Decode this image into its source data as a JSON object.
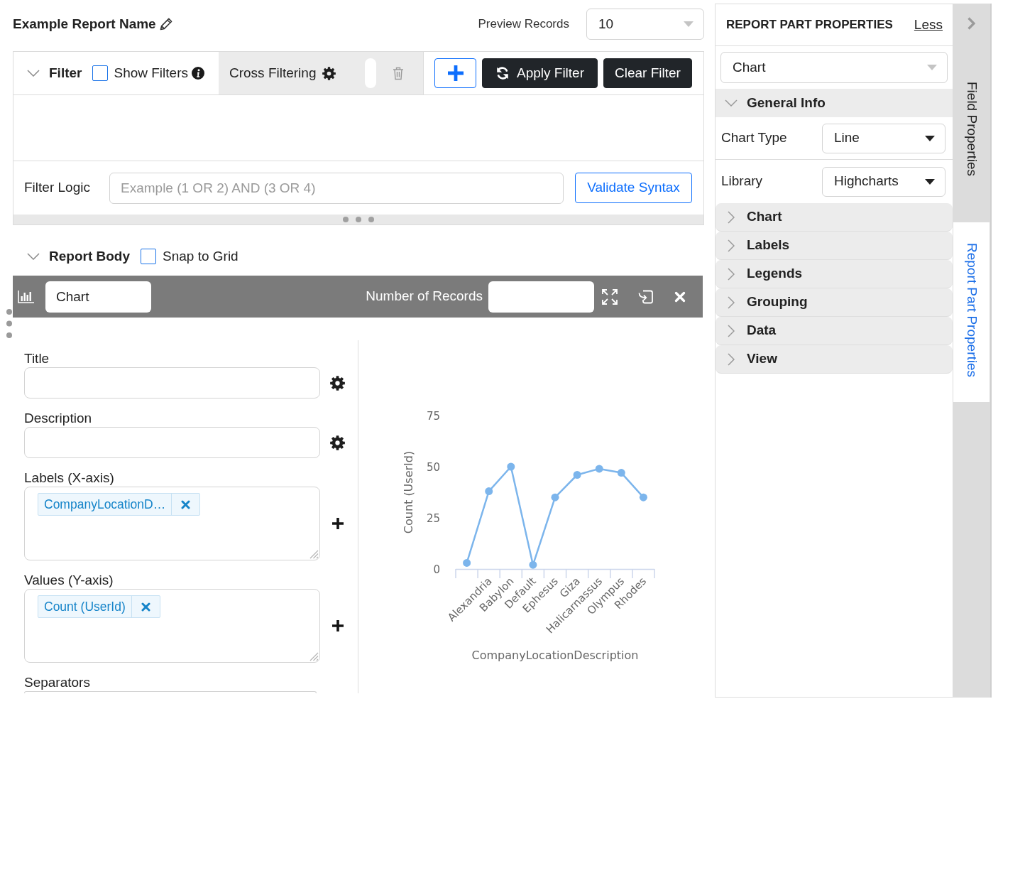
{
  "report": {
    "name": "Example Report Name",
    "preview_label": "Preview Records",
    "preview_value": "10"
  },
  "filter": {
    "title": "Filter",
    "expanded": true,
    "show_filters": {
      "label": "Show Filters",
      "checked": false
    },
    "cross_filtering": {
      "label": "Cross Filtering"
    },
    "buttons": [
      {
        "kind": "add"
      },
      {
        "kind": "apply",
        "label": "Apply Filter"
      },
      {
        "kind": "clear",
        "label": "Clear Filter"
      }
    ],
    "logic": {
      "label": "Filter Logic",
      "placeholder": "Example (1 OR 2) AND (3 OR 4)",
      "button": "Validate Syntax"
    }
  },
  "report_body": {
    "title": "Report Body",
    "expanded": true,
    "snap_to_grid": {
      "label": "Snap to Grid",
      "checked": false
    }
  },
  "report_part": {
    "name": "Chart",
    "records_label": "Number of Records",
    "fields": [
      {
        "kind": "text",
        "label": "Title"
      },
      {
        "kind": "text",
        "label": "Description"
      },
      {
        "kind": "chips",
        "label": "Labels (X-axis)",
        "chips": [
          "CompanyLocationD…"
        ]
      },
      {
        "kind": "chips",
        "label": "Values (Y-axis)",
        "chips": [
          "Count (UserId)"
        ]
      },
      {
        "kind": "partial",
        "label": "Separators"
      }
    ],
    "chart_data": {
      "type": "line",
      "xlabel": "CompanyLocationDescription",
      "ylabel": "Count (UserId)",
      "categories": [
        null,
        "Alexandria",
        "Babylon",
        "Default",
        "Ephesus",
        "Giza",
        "Halicarnassus",
        "Olympus",
        "Rhodes"
      ],
      "series": [
        {
          "color": "#7cb5ec",
          "marker": true,
          "values": [
            3,
            38,
            50,
            2,
            35,
            46,
            49,
            47,
            35
          ]
        }
      ],
      "ylim": [
        0,
        75
      ],
      "yticks": [
        0,
        25,
        50,
        75
      ]
    }
  },
  "properties": {
    "title": "REPORT PART PROPERTIES",
    "toggle_link": "Less",
    "part_select": "Chart",
    "sections": [
      {
        "title": "General Info",
        "expanded": true,
        "rows": [
          {
            "label": "Chart Type",
            "value": "Line"
          },
          {
            "label": "Library",
            "value": "Highcharts"
          }
        ]
      },
      {
        "title": "Chart",
        "expanded": false
      },
      {
        "title": "Labels",
        "expanded": false
      },
      {
        "title": "Legends",
        "expanded": false
      },
      {
        "title": "Grouping",
        "expanded": false
      },
      {
        "title": "Data",
        "expanded": false
      },
      {
        "title": "View",
        "expanded": false
      }
    ]
  },
  "side_tabs": [
    {
      "label": "Field Properties",
      "selected": false
    },
    {
      "label": "Report Part Properties",
      "selected": true
    }
  ]
}
